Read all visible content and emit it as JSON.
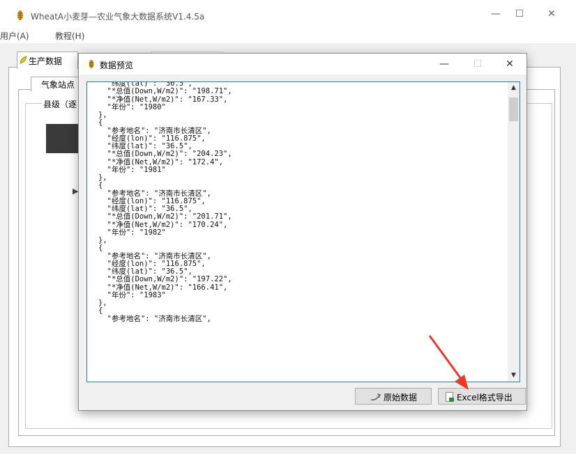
{
  "window": {
    "title": "WheatA小麦芽—农业气象大数据系统V1.4.5a",
    "minimize": "—",
    "maximize": "☐",
    "close": "✕"
  },
  "menu": {
    "items": [
      "用户(A)",
      "教程(H)"
    ]
  },
  "tabs": {
    "production": "生产数据"
  },
  "subtabs": {
    "station": "气象站点"
  },
  "group": {
    "label": "县级（逐"
  },
  "dialog": {
    "title": "数据预览",
    "minimize": "—",
    "maximize": "☐",
    "close": "✕",
    "json_text": "  \"纬度(lat)\": \"36.5\",\n  \"*总值(Down,W/m2)\": \"198.71\",\n  \"*净值(Net,W/m2)\": \"167.33\",\n  \"年份\": \"1980\"\n},\n{\n  \"参考地名\": \"济南市长清区\",\n  \"经度(lon)\": \"116.875\",\n  \"纬度(lat)\": \"36.5\",\n  \"*总值(Down,W/m2)\": \"204.23\",\n  \"*净值(Net,W/m2)\": \"172.4\",\n  \"年份\": \"1981\"\n},\n{\n  \"参考地名\": \"济南市长清区\",\n  \"经度(lon)\": \"116.875\",\n  \"纬度(lat)\": \"36.5\",\n  \"*总值(Down,W/m2)\": \"201.71\",\n  \"*净值(Net,W/m2)\": \"170.24\",\n  \"年份\": \"1982\"\n},\n{\n  \"参考地名\": \"济南市长清区\",\n  \"经度(lon)\": \"116.875\",\n  \"纬度(lat)\": \"36.5\",\n  \"*总值(Down,W/m2)\": \"197.22\",\n  \"*净值(Net,W/m2)\": \"166.41\",\n  \"年份\": \"1983\"\n},\n{\n  \"参考地名\": \"济南市长清区\",",
    "buttons": {
      "raw": "原始数据",
      "excel": "Excel格式导出"
    }
  },
  "colors": {
    "accent_border": "#2b78c5",
    "annotation_arrow": "#e8392b"
  }
}
